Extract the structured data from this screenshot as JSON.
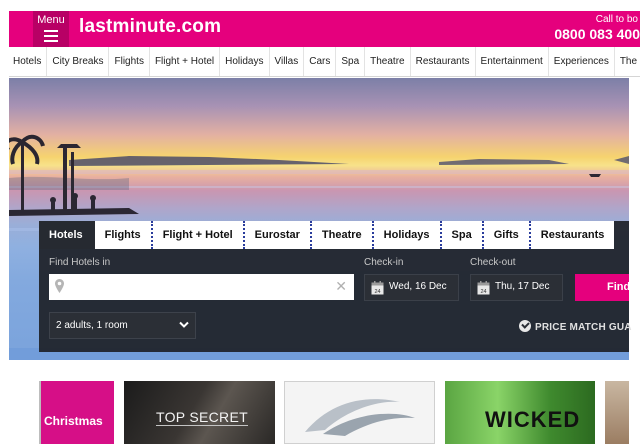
{
  "header": {
    "menu_label": "Menu",
    "logo_text": "lastminute.com",
    "call_label": "Call to bo",
    "call_number": "0800 083 400",
    "brand_color": "#e5007d"
  },
  "nav": {
    "items": [
      "Hotels",
      "City Breaks",
      "Flights",
      "Flight + Hotel",
      "Holidays",
      "Villas",
      "Cars",
      "Spa",
      "Theatre",
      "Restaurants",
      "Entertainment",
      "Experiences",
      "The Mix"
    ]
  },
  "search": {
    "tabs": [
      {
        "label": "Hotels",
        "active": true
      },
      {
        "label": "Flights",
        "active": false
      },
      {
        "label": "Flight + Hotel",
        "active": false
      },
      {
        "label": "Eurostar",
        "active": false
      },
      {
        "label": "Theatre",
        "active": false
      },
      {
        "label": "Holidays",
        "active": false
      },
      {
        "label": "Spa",
        "active": false
      },
      {
        "label": "Gifts",
        "active": false
      },
      {
        "label": "Restaurants",
        "active": false
      }
    ],
    "destination_label": "Find Hotels in",
    "destination_value": "",
    "destination_placeholder": "",
    "clear_glyph": "✕",
    "checkin_label": "Check-in",
    "checkin_value": "Wed, 16 Dec",
    "checkout_label": "Check-out",
    "checkout_value": "Thu, 17 Dec",
    "calendar_day": "24",
    "guests_value": "2 adults, 1 room",
    "find_label": "Find",
    "price_match": "PRICE MATCH GUA"
  },
  "promos": {
    "tile1_label": "Christmas",
    "tile2_label": "TOP SECRET",
    "tile4_label": "WICKED"
  },
  "icons": {
    "menu": "hamburger-icon",
    "pin": "map-pin-icon",
    "clear": "close-icon",
    "calendar": "calendar-icon",
    "chevron": "chevron-down-icon",
    "check": "check-circle-icon"
  }
}
